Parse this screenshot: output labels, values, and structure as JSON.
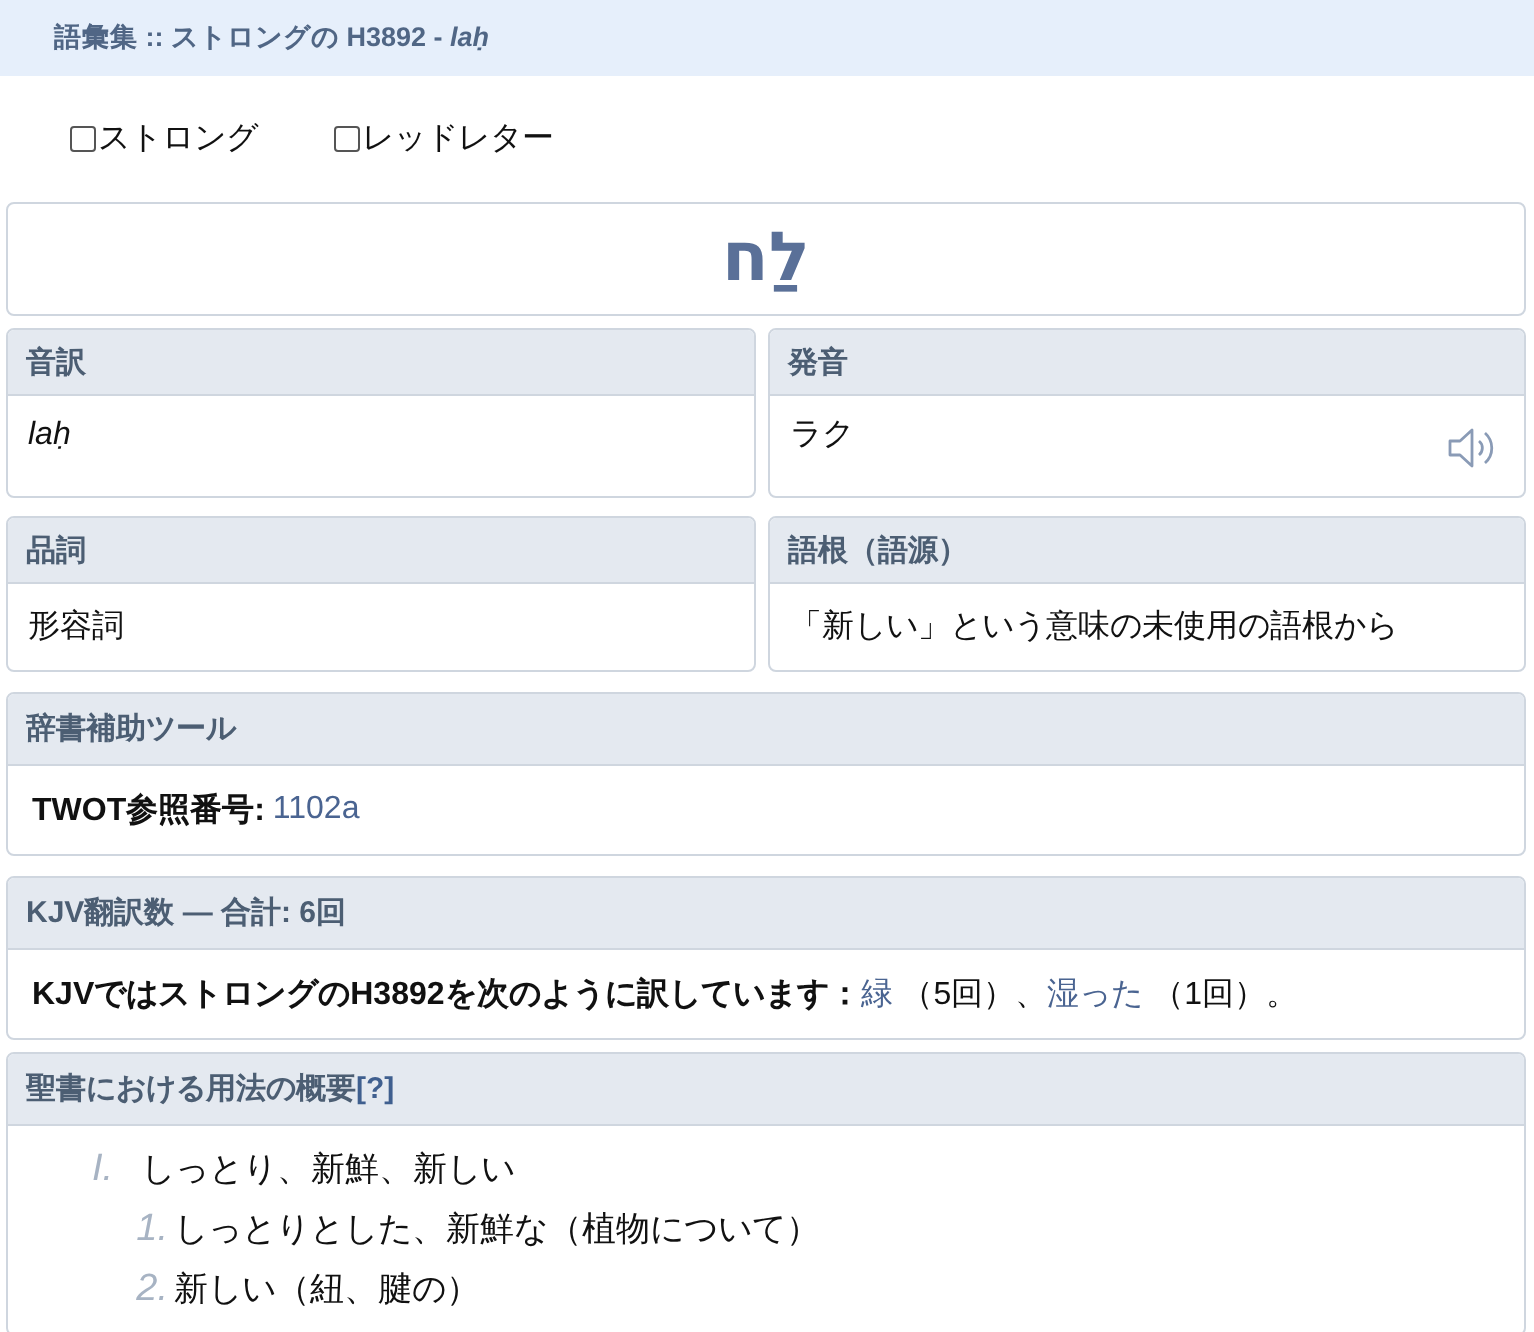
{
  "page_title": "語彙集 :: ストロングの H3892 - *laḥ*",
  "options": [
    {
      "label": "ストロング",
      "checked": false
    },
    {
      "label": "レッドレター",
      "checked": false
    }
  ],
  "word": {
    "hebrew": "לַח"
  },
  "info_rows": [
    [
      {
        "title": "音訳",
        "value": "laḥ",
        "kind": "transliteration"
      },
      {
        "title": "発音",
        "value": "ラク",
        "kind": "pronunciation"
      }
    ],
    [
      {
        "title": "品詞",
        "value": "形容詞",
        "kind": "plain"
      },
      {
        "title": "語根（語源）",
        "value": "「新しい」という意味の未使用の語根から",
        "kind": "plain"
      }
    ]
  ],
  "lexical_aids": {
    "title": "辞書補助ツール",
    "label": "TWOT参照番号:",
    "reference": "1102a"
  },
  "kjv": {
    "title": "KJV翻訳数 — 合計: 6回",
    "lead": "KJVではストロングのH3892を次のように訳しています：",
    "translations": [
      {
        "word": "緑",
        "count": "（5回）、"
      },
      {
        "word": "湿った",
        "count": "（1回）。"
      }
    ]
  },
  "usage": {
    "title": "聖書における用法の概要",
    "help": "[?]",
    "outline": [
      {
        "marker": "I.",
        "text": "しっとり、新鮮、新しい",
        "children": [
          {
            "marker": "1.",
            "text": "しっとりとした、新鮮な（植物について）"
          },
          {
            "marker": "2.",
            "text": "新しい（紐、腱の）"
          }
        ]
      }
    ]
  }
}
